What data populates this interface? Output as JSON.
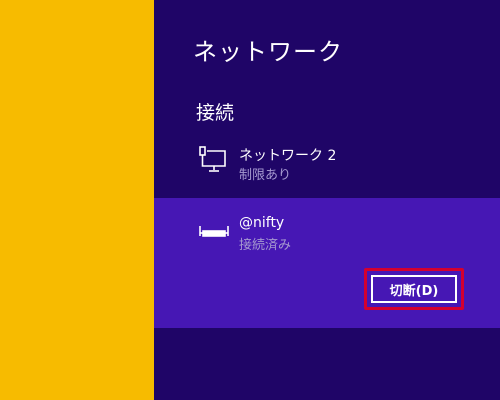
{
  "panel": {
    "title": "ネットワーク",
    "section_header": "接続",
    "networks": [
      {
        "name": "ネットワーク 2",
        "status": "制限あり",
        "icon": "wired-ethernet-icon"
      },
      {
        "name": "@nifty",
        "status": "接続済み",
        "icon": "dialup-broadband-icon",
        "disconnect_label": "切断(D)"
      }
    ]
  },
  "colors": {
    "background_accent": "#f7bb00",
    "panel_bg": "#1f0567",
    "selected_item_bg": "#4617b4",
    "status_text": "#a69ad0",
    "highlight_border": "#d4002f"
  }
}
